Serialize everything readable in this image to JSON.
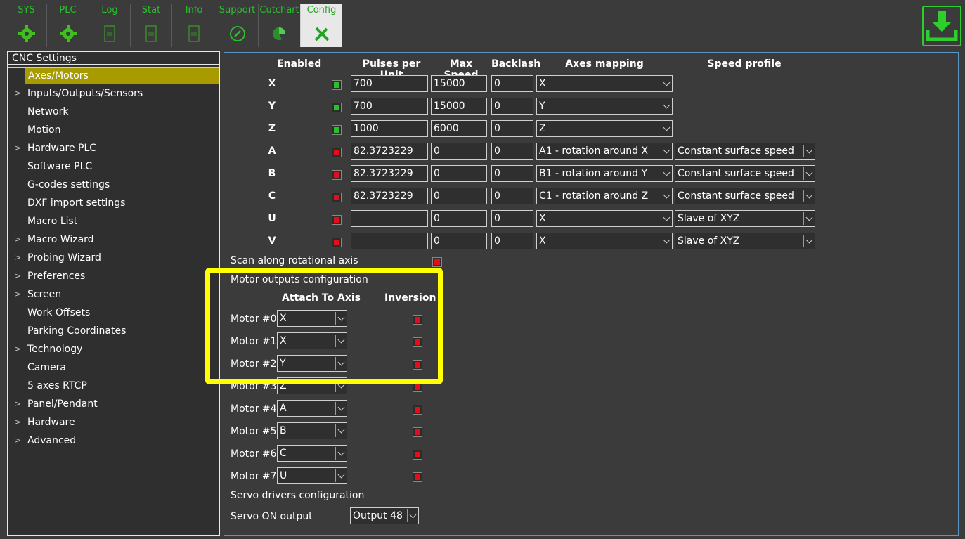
{
  "toolbar": {
    "tabs": [
      {
        "label": "SYS",
        "icon": "gear-icon"
      },
      {
        "label": "PLC",
        "icon": "gear-icon"
      },
      {
        "label": "Log",
        "icon": "log-icon"
      },
      {
        "label": "Stat",
        "icon": "stat-icon"
      },
      {
        "label": "Info",
        "icon": "info-icon"
      },
      {
        "label": "Support",
        "icon": "phone-icon"
      },
      {
        "label": "Cutchart",
        "icon": "pie-chart-icon"
      },
      {
        "label": "Config",
        "icon": "tools-icon"
      }
    ],
    "active_tab": "Config",
    "save_icon": "save-download-icon",
    "accent_color": "#27c22a"
  },
  "sidebar": {
    "header": "CNC Settings",
    "items": [
      {
        "label": "Axes/Motors",
        "expandable": false,
        "selected": true
      },
      {
        "label": "Inputs/Outputs/Sensors",
        "expandable": true
      },
      {
        "label": "Network",
        "expandable": false
      },
      {
        "label": "Motion",
        "expandable": false
      },
      {
        "label": "Hardware PLC",
        "expandable": true
      },
      {
        "label": "Software PLC",
        "expandable": false
      },
      {
        "label": "G-codes settings",
        "expandable": false
      },
      {
        "label": "DXF import settings",
        "expandable": false
      },
      {
        "label": "Macro List",
        "expandable": false
      },
      {
        "label": "Macro Wizard",
        "expandable": true
      },
      {
        "label": "Probing Wizard",
        "expandable": true
      },
      {
        "label": "Preferences",
        "expandable": true
      },
      {
        "label": "Screen",
        "expandable": true
      },
      {
        "label": "Work Offsets",
        "expandable": false
      },
      {
        "label": "Parking Coordinates",
        "expandable": false
      },
      {
        "label": "Technology",
        "expandable": true
      },
      {
        "label": "Camera",
        "expandable": false
      },
      {
        "label": "5 axes RTCP",
        "expandable": false
      },
      {
        "label": "Panel/Pendant",
        "expandable": true
      },
      {
        "label": "Hardware",
        "expandable": true
      },
      {
        "label": "Advanced",
        "expandable": true
      }
    ]
  },
  "axes_table": {
    "headers": {
      "enabled": "Enabled",
      "pulses": "Pulses per Unit",
      "max_speed": "Max Speed",
      "backlash": "Backlash",
      "mapping": "Axes mapping",
      "profile": "Speed profile"
    },
    "rows": [
      {
        "axis": "X",
        "enabled": true,
        "pulses": "700",
        "max_speed": "15000",
        "backlash": "0",
        "mapping": "X",
        "profile": null
      },
      {
        "axis": "Y",
        "enabled": true,
        "pulses": "700",
        "max_speed": "15000",
        "backlash": "0",
        "mapping": "Y",
        "profile": null
      },
      {
        "axis": "Z",
        "enabled": true,
        "pulses": "1000",
        "max_speed": "6000",
        "backlash": "0",
        "mapping": "Z",
        "profile": null
      },
      {
        "axis": "A",
        "enabled": false,
        "pulses": "82.3723229",
        "max_speed": "0",
        "backlash": "0",
        "mapping": "A1 - rotation around X",
        "profile": "Constant surface speed"
      },
      {
        "axis": "B",
        "enabled": false,
        "pulses": "82.3723229",
        "max_speed": "0",
        "backlash": "0",
        "mapping": "B1 - rotation around Y",
        "profile": "Constant surface speed"
      },
      {
        "axis": "C",
        "enabled": false,
        "pulses": "82.3723229",
        "max_speed": "0",
        "backlash": "0",
        "mapping": "C1 - rotation around Z",
        "profile": "Constant surface speed"
      },
      {
        "axis": "U",
        "enabled": false,
        "pulses": "",
        "max_speed": "0",
        "backlash": "0",
        "mapping": "X",
        "profile": "Slave of XYZ"
      },
      {
        "axis": "V",
        "enabled": false,
        "pulses": "",
        "max_speed": "0",
        "backlash": "0",
        "mapping": "X",
        "profile": "Slave of XYZ"
      }
    ]
  },
  "scan_rotational": {
    "label": "Scan along rotational axis",
    "checked": false
  },
  "motor_outputs": {
    "title": "Motor outputs configuration",
    "col_attach": "Attach To Axis",
    "col_inversion": "Inversion",
    "motors": [
      {
        "label": "Motor #0",
        "axis": "X",
        "inverted": false
      },
      {
        "label": "Motor #1",
        "axis": "X",
        "inverted": false
      },
      {
        "label": "Motor #2",
        "axis": "Y",
        "inverted": false
      },
      {
        "label": "Motor #3",
        "axis": "Z",
        "inverted": false
      },
      {
        "label": "Motor #4",
        "axis": "A",
        "inverted": false
      },
      {
        "label": "Motor #5",
        "axis": "B",
        "inverted": false
      },
      {
        "label": "Motor #6",
        "axis": "C",
        "inverted": false
      },
      {
        "label": "Motor #7",
        "axis": "U",
        "inverted": false
      }
    ]
  },
  "servo": {
    "title": "Servo drivers configuration",
    "on_label": "Servo ON output",
    "on_value": "Output 48"
  },
  "colors": {
    "background": "#3b3b3b",
    "selected_item": "#a89b00",
    "panel_border": "#5a97c2",
    "highlight": "#ffff00",
    "checkbox_on": "#2bbf2b",
    "checkbox_off": "#e0101a"
  }
}
